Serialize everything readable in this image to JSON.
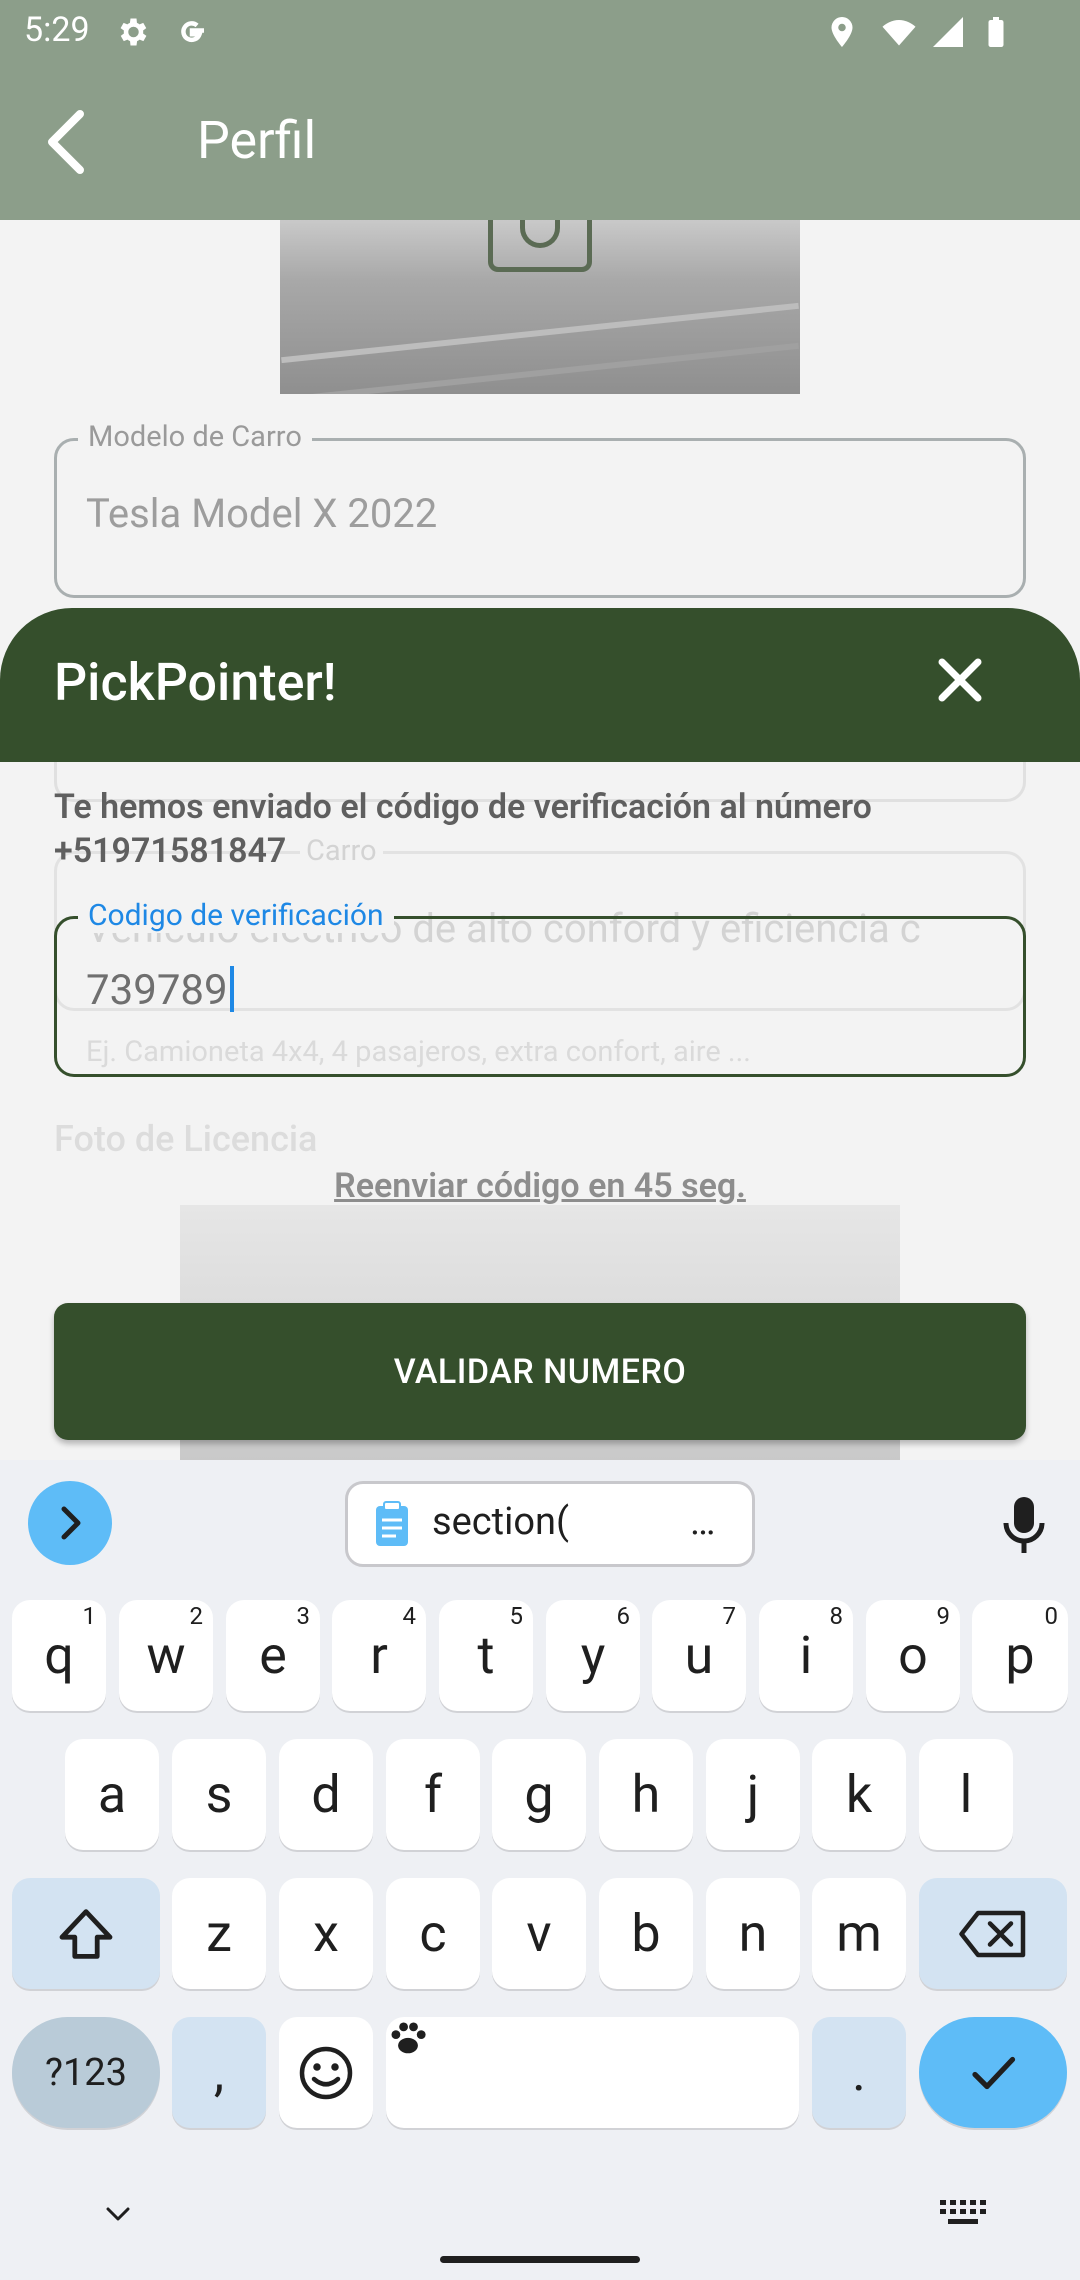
{
  "status_bar": {
    "time": "5:29"
  },
  "app_bar": {
    "title": "Perfil"
  },
  "form": {
    "car_model": {
      "label": "Modelo de Carro",
      "value": "Tesla Model X 2022"
    },
    "car_description": {
      "label": "Carro",
      "value": "Vehículo eléctrico de alto conford y eficiencia c",
      "placeholder": "Ej. Camioneta 4x4, 4 pasajeros, extra confort, aire ..."
    },
    "license_photo_label": "Foto de Licencia"
  },
  "sheet": {
    "title": "PickPointer!",
    "message_line1": "Te hemos enviado el código de verificación al número",
    "message_line2": "+51971581847",
    "code_field": {
      "label": "Codigo de verificación",
      "value": "739789"
    },
    "resend": "Reenviar código en 45 seg.",
    "validate_button": "VALIDAR NUMERO"
  },
  "keyboard": {
    "clipboard_chip": "section(",
    "clipboard_ellipsis": "…",
    "row1": [
      {
        "k": "q",
        "h": "1"
      },
      {
        "k": "w",
        "h": "2"
      },
      {
        "k": "e",
        "h": "3"
      },
      {
        "k": "r",
        "h": "4"
      },
      {
        "k": "t",
        "h": "5"
      },
      {
        "k": "y",
        "h": "6"
      },
      {
        "k": "u",
        "h": "7"
      },
      {
        "k": "i",
        "h": "8"
      },
      {
        "k": "o",
        "h": "9"
      },
      {
        "k": "p",
        "h": "0"
      }
    ],
    "row2": [
      "a",
      "s",
      "d",
      "f",
      "g",
      "h",
      "j",
      "k",
      "l"
    ],
    "row3": [
      "z",
      "x",
      "c",
      "v",
      "b",
      "n",
      "m"
    ],
    "symbols_key": "?123",
    "comma_key": ",",
    "period_key": "."
  },
  "colors": {
    "primary": "#354f2c",
    "accent": "#1e88e5",
    "keyboard_accent": "#5ebcf7"
  }
}
